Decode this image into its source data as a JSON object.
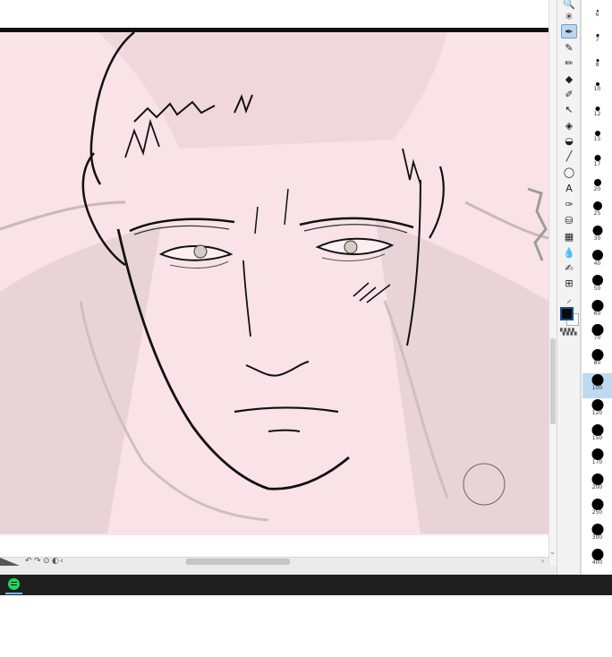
{
  "brush_sizes": [
    {
      "label": "6",
      "selected": false
    },
    {
      "label": "7",
      "selected": false
    },
    {
      "label": "8",
      "selected": false
    },
    {
      "label": "10",
      "selected": false
    },
    {
      "label": "12",
      "selected": false
    },
    {
      "label": "15",
      "selected": false
    },
    {
      "label": "17",
      "selected": false
    },
    {
      "label": "20",
      "selected": false
    },
    {
      "label": "25",
      "selected": false
    },
    {
      "label": "30",
      "selected": false
    },
    {
      "label": "40",
      "selected": false
    },
    {
      "label": "50",
      "selected": false
    },
    {
      "label": "60",
      "selected": false
    },
    {
      "label": "70",
      "selected": false
    },
    {
      "label": "80",
      "selected": false
    },
    {
      "label": "100",
      "selected": true
    },
    {
      "label": "120",
      "selected": false
    },
    {
      "label": "150",
      "selected": false
    },
    {
      "label": "170",
      "selected": false
    },
    {
      "label": "200",
      "selected": false
    },
    {
      "label": "250",
      "selected": false
    },
    {
      "label": "300",
      "selected": false
    },
    {
      "label": "400",
      "selected": false
    }
  ],
  "tools": [
    {
      "icon": "zoom-icon",
      "glyph": "🔍"
    },
    {
      "icon": "sparkle-icon",
      "glyph": "✳"
    },
    {
      "icon": "pen-icon",
      "glyph": "✒"
    },
    {
      "icon": "pencil-icon",
      "glyph": "✎"
    },
    {
      "icon": "brush-icon",
      "glyph": "✏"
    },
    {
      "icon": "fill-icon",
      "glyph": "◆"
    },
    {
      "icon": "marker-icon",
      "glyph": "✐"
    },
    {
      "icon": "select-arrow-icon",
      "glyph": "↖"
    },
    {
      "icon": "eraser-icon",
      "glyph": "◈"
    },
    {
      "icon": "blend-icon",
      "glyph": "◒"
    },
    {
      "icon": "line-icon",
      "glyph": "╱"
    },
    {
      "icon": "lasso-icon",
      "glyph": "◯"
    },
    {
      "icon": "text-icon",
      "glyph": "A"
    },
    {
      "icon": "ink-pen-icon",
      "glyph": "✑"
    },
    {
      "icon": "bucket-icon",
      "glyph": "⛁"
    },
    {
      "icon": "gradient-icon",
      "glyph": "▦"
    },
    {
      "icon": "droplet-icon",
      "glyph": "💧"
    },
    {
      "icon": "eyedropper-icon",
      "glyph": "✍"
    },
    {
      "icon": "grid-icon",
      "glyph": "⊞"
    },
    {
      "icon": "ruler-icon",
      "glyph": "⸝"
    }
  ],
  "active_tool": "pen-icon",
  "colors": {
    "foreground": "#0b0b0b",
    "background": "#ffffff",
    "canvas_tint": "#f9e3e6",
    "selection": "#bfd9f2"
  },
  "taskbar": {
    "app_icon": "spotify-icon"
  }
}
